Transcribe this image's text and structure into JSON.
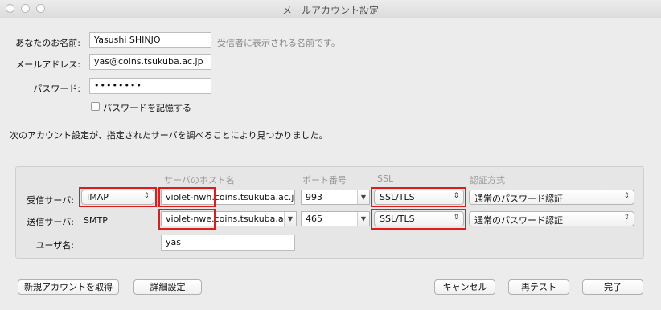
{
  "window": {
    "title": "メールアカウント設定"
  },
  "form": {
    "name_label": "あなたのお名前:",
    "name_value": "Yasushi SHINJO",
    "name_hint": "受信者に表示される名前です。",
    "email_label": "メールアドレス:",
    "email_value": "yas@coins.tsukuba.ac.jp",
    "password_label": "パスワード:",
    "password_value": "••••••••",
    "remember_label": "パスワードを記憶する",
    "status_message": "次のアカウント設定が、指定されたサーバを調べることにより見つかりました。"
  },
  "servers": {
    "columns": {
      "host": "サーバのホスト名",
      "port": "ポート番号",
      "ssl": "SSL",
      "auth": "認証方式"
    },
    "incoming": {
      "label": "受信サーバ:",
      "protocol": "IMAP",
      "host": "violet-nwh.coins.tsukuba.ac.jp",
      "port": "993",
      "ssl": "SSL/TLS",
      "auth": "通常のパスワード認証"
    },
    "outgoing": {
      "label": "送信サーバ:",
      "protocol": "SMTP",
      "host": "violet-nwe.coins.tsukuba.ac.jp",
      "port": "465",
      "ssl": "SSL/TLS",
      "auth": "通常のパスワード認証"
    },
    "username_label": "ユーザ名:",
    "username_value": "yas"
  },
  "buttons": {
    "new_account": "新規アカウントを取得",
    "advanced": "詳細設定",
    "cancel": "キャンセル",
    "retest": "再テスト",
    "done": "完了"
  },
  "icons": {
    "popup_arrows": "up-down-arrows-icon",
    "dropdown": "chevron-down-icon"
  },
  "colors": {
    "highlight_box": "#e01b1b"
  }
}
